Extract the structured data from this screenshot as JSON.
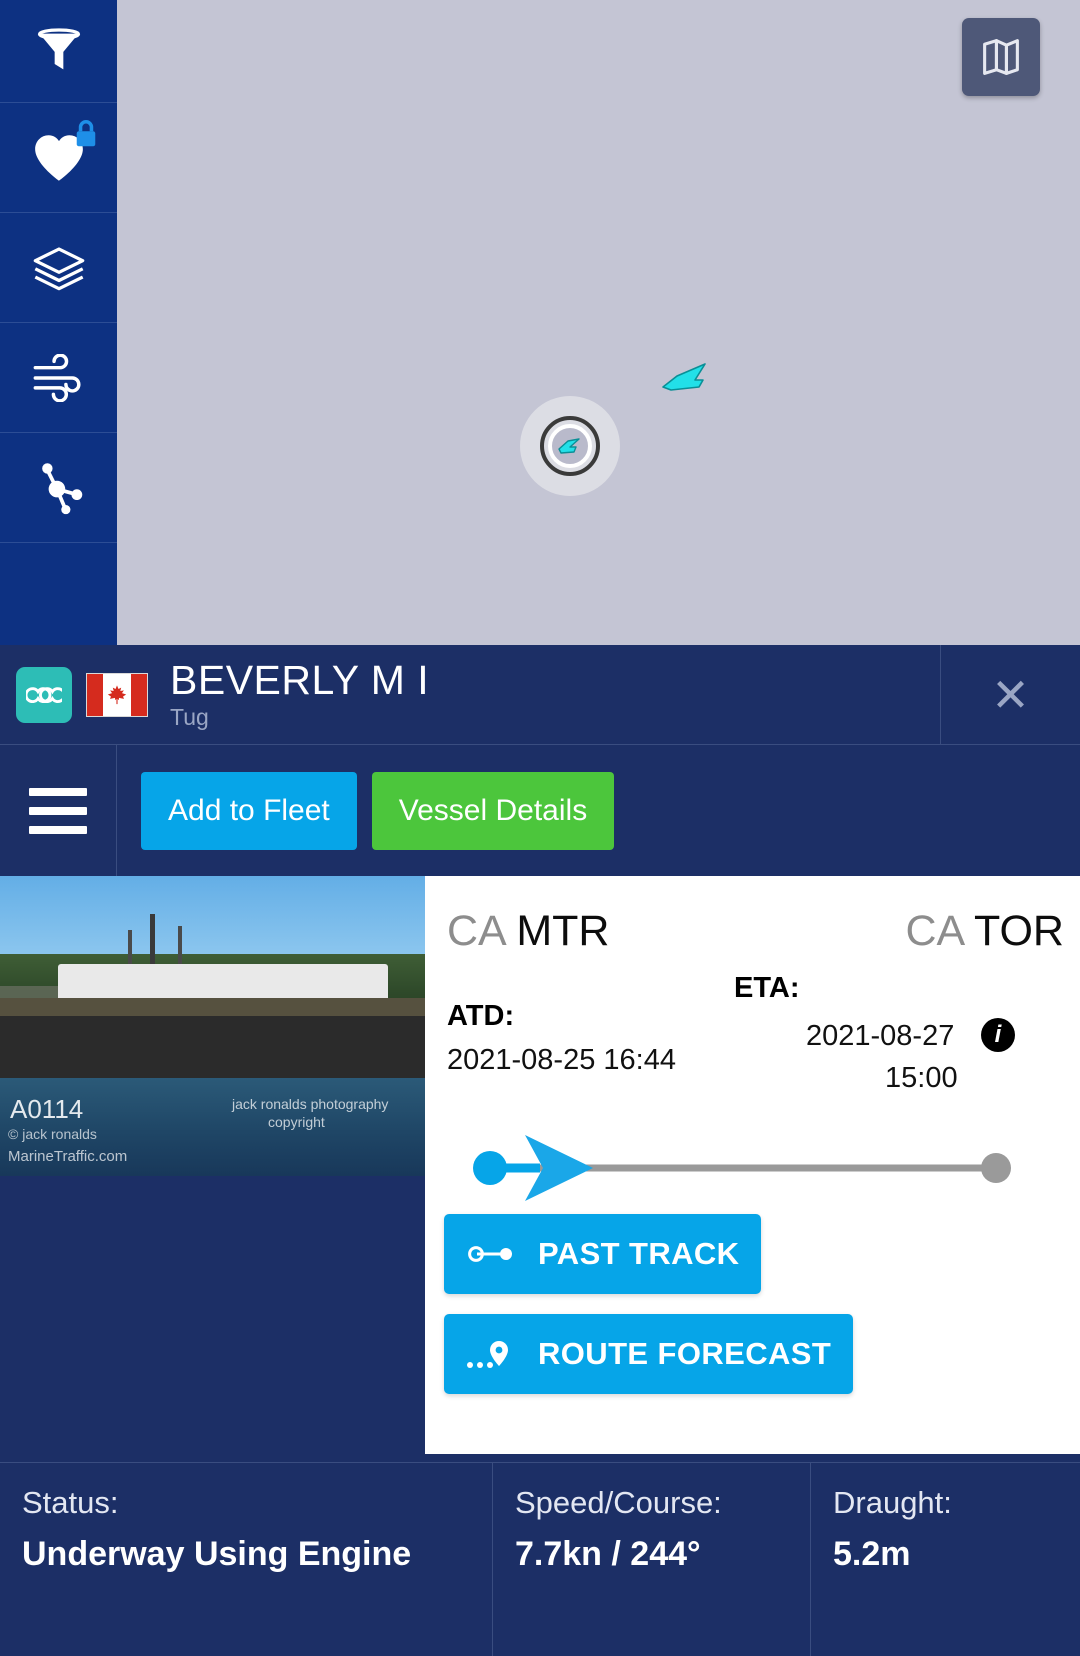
{
  "map": {
    "toggle_icon": "map-layers-icon",
    "selected_vessel_marker": "selected-vessel-marker",
    "nearby_vessel_marker": "nearby-vessel-marker"
  },
  "sidebar": {
    "items": [
      {
        "name": "filter",
        "icon": "funnel-icon",
        "locked": false
      },
      {
        "name": "fleet",
        "icon": "heart-icon",
        "locked": true
      },
      {
        "name": "layers",
        "icon": "layers-icon",
        "locked": false
      },
      {
        "name": "weather",
        "icon": "wind-icon",
        "locked": false
      },
      {
        "name": "density",
        "icon": "network-icon",
        "locked": false
      }
    ]
  },
  "vessel": {
    "name": "BEVERLY M I",
    "type": "Tug",
    "flag_country": "Canada",
    "link_icon": "chain-link-icon",
    "close_label": "✕"
  },
  "actions": {
    "menu_icon": "hamburger-menu-icon",
    "add_to_fleet": "Add to Fleet",
    "vessel_details": "Vessel Details"
  },
  "photo": {
    "watermark_id": "A0114",
    "watermark_author": "© jack ronalds",
    "watermark_site": "MarineTraffic.com",
    "watermark_photography": "jack ronalds photography",
    "watermark_copyright": "copyright"
  },
  "voyage": {
    "from": {
      "country": "CA",
      "port": "MTR"
    },
    "to": {
      "country": "CA",
      "port": "TOR"
    },
    "atd_label": "ATD:",
    "atd_value": "2021-08-25 16:44",
    "eta_label": "ETA:",
    "eta_date": "2021-08-27",
    "eta_time": "15:00",
    "eta_info_icon": "info-icon",
    "progress_percent": 10
  },
  "buttons": {
    "past_track": {
      "label": "PAST TRACK",
      "icon": "track-line-icon"
    },
    "route_forecast": {
      "label": "ROUTE FORECAST",
      "icon": "route-pin-icon"
    }
  },
  "status": {
    "status_label": "Status:",
    "status_value": "Underway Using Engine",
    "speed_label": "Speed/Course:",
    "speed_value": "7.7kn / 244°",
    "draught_label": "Draught:",
    "draught_value": "5.2m"
  },
  "colors": {
    "panel_bg": "#1c2f66",
    "sidebar_bg": "#0d3182",
    "accent_blue": "#06a5e8",
    "accent_green": "#4cc63c",
    "vessel_cyan": "#22e0e8",
    "map_bg": "#c4c5d4"
  }
}
